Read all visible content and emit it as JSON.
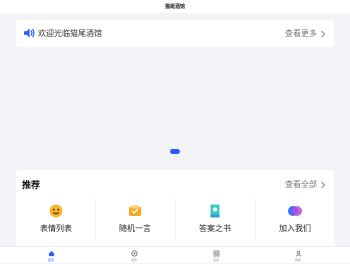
{
  "app": {
    "title": "猫尾酒馆"
  },
  "notice": {
    "icon": "speaker-icon",
    "text": "欢迎光临猫尾酒馆",
    "more_label": "查看更多"
  },
  "banner": {
    "active_index": 0,
    "count": 1
  },
  "recommend": {
    "title": "推荐",
    "more_label": "查看全部",
    "items": [
      {
        "label": "表情列表",
        "icon": "emoji-icon"
      },
      {
        "label": "随机一言",
        "icon": "message-icon"
      },
      {
        "label": "答案之书",
        "icon": "book-icon"
      },
      {
        "label": "加入我们",
        "icon": "join-icon"
      }
    ]
  },
  "tabbar": {
    "tabs": [
      {
        "label": "首页",
        "icon": "home-icon",
        "active": true
      },
      {
        "label": "发现",
        "icon": "discover-icon",
        "active": false
      },
      {
        "label": "应用",
        "icon": "apps-icon",
        "active": false
      },
      {
        "label": "我的",
        "icon": "profile-icon",
        "active": false
      }
    ]
  },
  "colors": {
    "accent": "#2e5bff",
    "background": "#f3f4f8"
  }
}
